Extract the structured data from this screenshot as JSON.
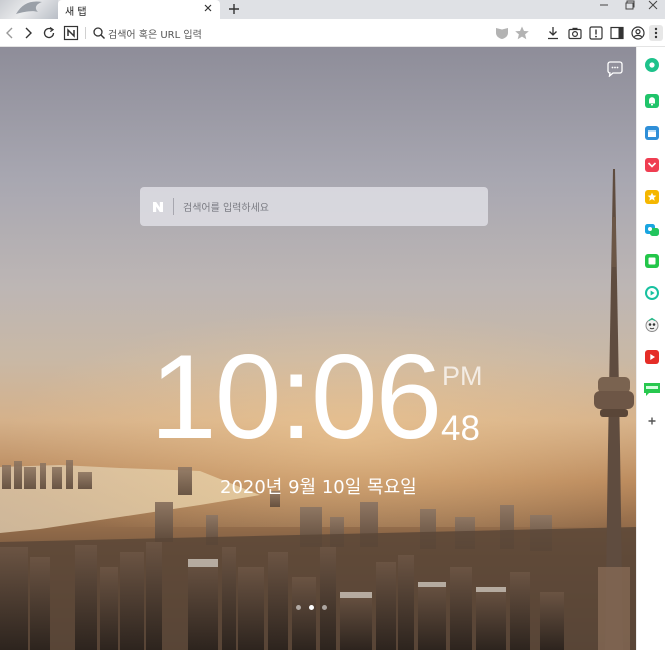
{
  "tab": {
    "title": "새 탭"
  },
  "address_bar": {
    "placeholder": "검색어 혹은 URL 입력"
  },
  "search": {
    "placeholder": "검색어를 입력하세요"
  },
  "clock": {
    "hours_minutes": "10:06",
    "ampm": "PM",
    "seconds": "48",
    "date": "2020년 9월 10일 목요일"
  },
  "pager": {
    "count": 3,
    "active_index": 1
  },
  "sidebar": {
    "items": [
      {
        "name": "whale-space",
        "color": "#1ec28b"
      },
      {
        "name": "notification",
        "color": "#20c46a"
      },
      {
        "name": "calendar",
        "color": "#2f8fd8"
      },
      {
        "name": "pocket",
        "color": "#ef3e52"
      },
      {
        "name": "bookmark-star",
        "color": "#f5b700"
      },
      {
        "name": "translate",
        "color": "#1aa5e0"
      },
      {
        "name": "memo",
        "color": "#23c649"
      },
      {
        "name": "music",
        "color": "#18c1a0"
      },
      {
        "name": "papago",
        "color": "#8b8b8b"
      },
      {
        "name": "youtube",
        "color": "#e52d27"
      },
      {
        "name": "webtoon",
        "color": "#28c84f"
      },
      {
        "name": "add",
        "color": "#555555"
      }
    ]
  },
  "colors": {
    "accent": "#22c55e"
  }
}
